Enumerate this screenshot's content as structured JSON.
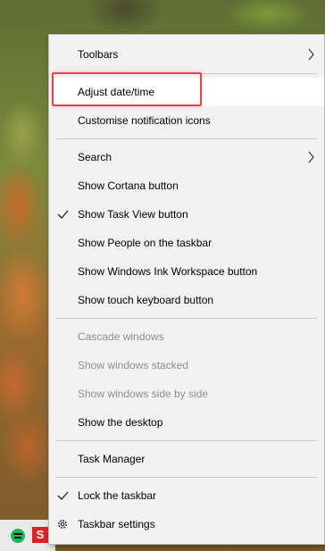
{
  "taskbar": {
    "icons": [
      "spotify-icon",
      "app-red-s-icon"
    ],
    "red_icon_letter": "S"
  },
  "colors": {
    "menu_bg": "#f2f2f2",
    "disabled_text": "#8e8e8e",
    "highlight_box": "#e0464f"
  },
  "menu": {
    "toolbars": "Toolbars",
    "adjust_datetime": "Adjust date/time",
    "customise_notification_icons": "Customise notification icons",
    "search": "Search",
    "show_cortana": "Show Cortana button",
    "show_task_view": "Show Task View button",
    "show_people": "Show People on the taskbar",
    "show_ink_workspace": "Show Windows Ink Workspace button",
    "show_touch_keyboard": "Show touch keyboard button",
    "cascade_windows": "Cascade windows",
    "show_windows_stacked": "Show windows stacked",
    "show_windows_side_by_side": "Show windows side by side",
    "show_desktop": "Show the desktop",
    "task_manager": "Task Manager",
    "lock_taskbar": "Lock the taskbar",
    "taskbar_settings": "Taskbar settings"
  },
  "state": {
    "show_task_view_checked": true,
    "lock_taskbar_checked": true,
    "highlighted_item": "Adjust date/time",
    "disabled_items": [
      "Cascade windows",
      "Show windows stacked",
      "Show windows side by side"
    ]
  }
}
